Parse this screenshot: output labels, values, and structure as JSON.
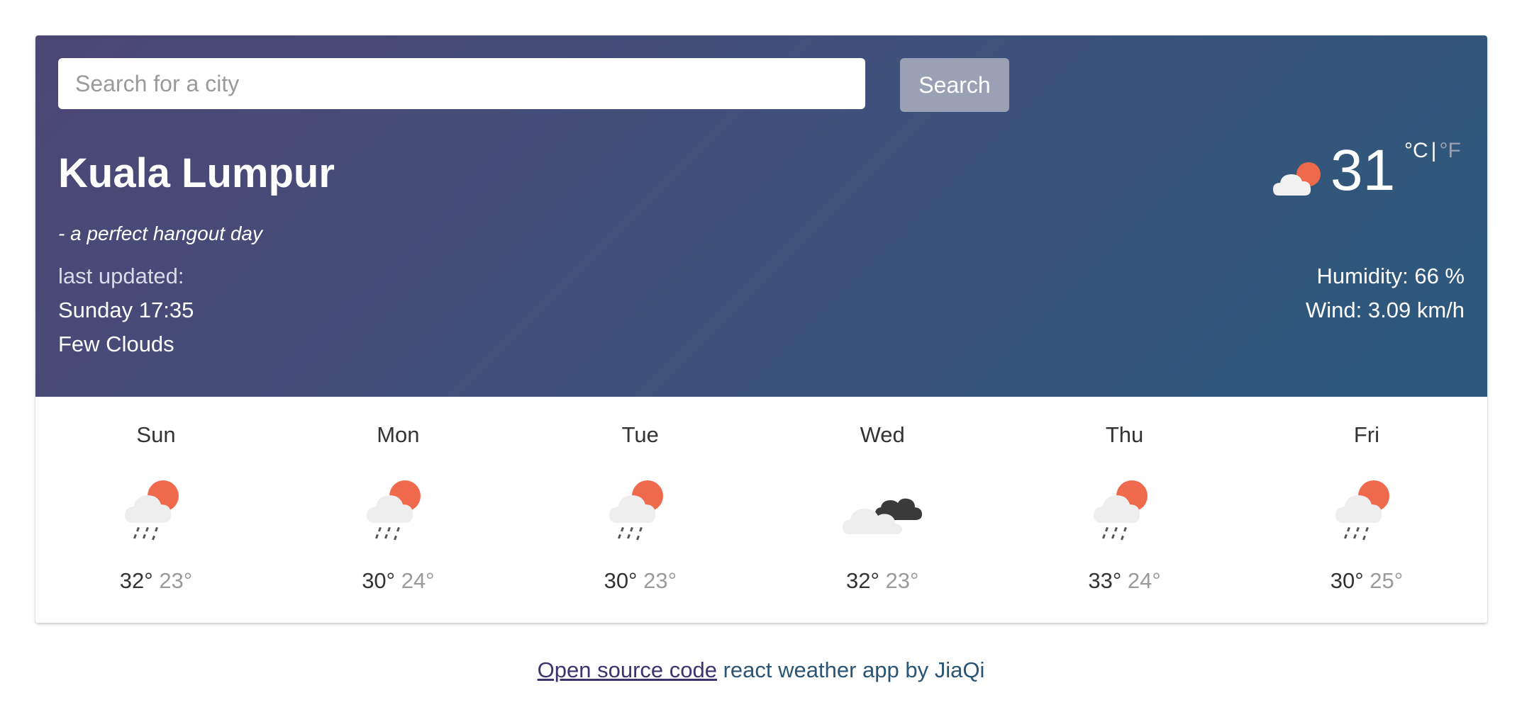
{
  "search": {
    "placeholder": "Search for a city",
    "value": "",
    "button_label": "Search"
  },
  "current": {
    "city": "Kuala Lumpur",
    "tagline": "- a perfect hangout day",
    "last_updated_label": "last updated:",
    "last_updated": "Sunday 17:35",
    "condition": "Few Clouds",
    "icon": "few-clouds-icon",
    "temperature": "31",
    "unit_celsius": "°C",
    "unit_separator": "|",
    "unit_fahrenheit": "°F",
    "humidity": "Humidity: 66 %",
    "wind": "Wind: 3.09 km/h"
  },
  "forecast": [
    {
      "day": "Sun",
      "icon": "light-rain-sun-icon",
      "max": "32°",
      "min": "23°"
    },
    {
      "day": "Mon",
      "icon": "light-rain-sun-icon",
      "max": "30°",
      "min": "24°"
    },
    {
      "day": "Tue",
      "icon": "light-rain-sun-icon",
      "max": "30°",
      "min": "23°"
    },
    {
      "day": "Wed",
      "icon": "broken-clouds-icon",
      "max": "32°",
      "min": "23°"
    },
    {
      "day": "Thu",
      "icon": "light-rain-sun-icon",
      "max": "33°",
      "min": "24°"
    },
    {
      "day": "Fri",
      "icon": "light-rain-sun-icon",
      "max": "30°",
      "min": "25°"
    }
  ],
  "footer": {
    "link_text": "Open source code",
    "text": " react weather app by JiaQi"
  },
  "colors": {
    "sun": "#ef6a4c",
    "cloud_light": "#eeeeee",
    "cloud_dark": "#3a3a3a",
    "rain": "#555555",
    "gradient_start": "#4c4675",
    "gradient_end": "#2b5a7c"
  }
}
